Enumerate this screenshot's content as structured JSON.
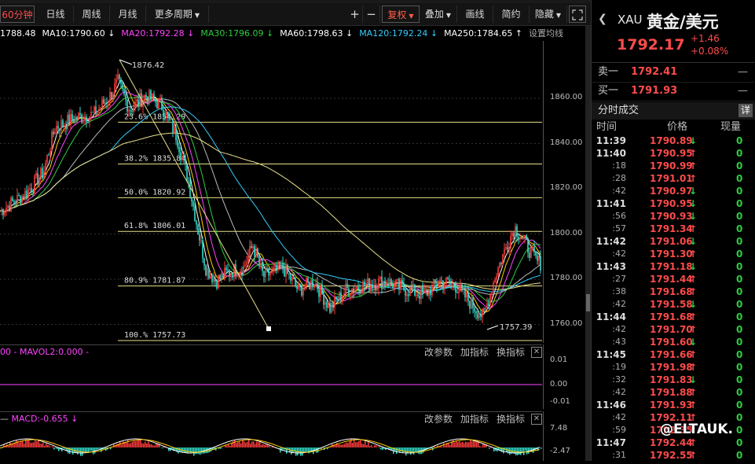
{
  "toolbar": {
    "periods": [
      "60分钟",
      "日线",
      "周线",
      "月线",
      "更多周期"
    ],
    "tools": [
      "+",
      "−",
      "复权",
      "叠加",
      "画线",
      "简约",
      "隐藏"
    ],
    "expand_icon": "expand-icon"
  },
  "ma_line": [
    {
      "text": "1788.48",
      "color": "#ffffff"
    },
    {
      "text": "MA10:1790.60 ↓",
      "color": "#ffffff"
    },
    {
      "text": "MA20:1792.28 ↓",
      "color": "#ff44ff"
    },
    {
      "text": "MA30:1796.09 ↓",
      "color": "#2ecc40"
    },
    {
      "text": "MA60:1798.63 ↓",
      "color": "#ffffff"
    },
    {
      "text": "MA120:1792.24 ↓",
      "color": "#33ccff"
    },
    {
      "text": "MA250:1784.65 ↑",
      "color": "#ffffff"
    },
    {
      "text": "设置均线",
      "color": "#aaaaaa"
    }
  ],
  "main_chart": {
    "y_ticks": [
      "1860.00",
      "1840.00",
      "1820.00",
      "1800.00",
      "1780.00",
      "1760.00"
    ],
    "high_label": "1876.42",
    "low_label": "1757.39",
    "fib_levels": [
      "23.6% 1854.29",
      "38.2% 1835.84",
      "50.0% 1820.92",
      "61.8% 1806.01",
      "80.9% 1781.87",
      "100.% 1757.73"
    ]
  },
  "vol_pane": {
    "header": "00 - MAVOL2:0.000 -",
    "buttons": [
      "改参数",
      "加指标",
      "换指标"
    ],
    "y_ticks": [
      "0.01",
      "0.00",
      "-0.01"
    ]
  },
  "macd_pane": {
    "header": "MACD:-0.655 ↓",
    "buttons": [
      "改参数",
      "加指标",
      "换指标"
    ],
    "y_ticks": [
      "7.48",
      "-2.47"
    ]
  },
  "quote": {
    "code": "XAU",
    "name": "黄金/美元",
    "price": "1792.17",
    "change": "+1.46",
    "change_pct": "+0.08%",
    "sell_label": "卖一",
    "sell_price": "1792.41",
    "buy_label": "买一",
    "buy_price": "1791.93",
    "dash": "—"
  },
  "ticks": {
    "title": "分时成交",
    "detail": "详",
    "headers": [
      "时间",
      "价格",
      "现量"
    ],
    "rows": [
      {
        "time": "11:39",
        "big": true,
        "price": "1790.89",
        "dir": "down",
        "vol": "0"
      },
      {
        "time": "11:40",
        "big": true,
        "price": "1790.95",
        "dir": "up",
        "vol": "0"
      },
      {
        "time": ":18",
        "big": false,
        "price": "1790.99",
        "dir": "up",
        "vol": "0"
      },
      {
        "time": ":28",
        "big": false,
        "price": "1791.01",
        "dir": "up",
        "vol": "0"
      },
      {
        "time": ":42",
        "big": false,
        "price": "1790.97",
        "dir": "down",
        "vol": "0"
      },
      {
        "time": "11:41",
        "big": true,
        "price": "1790.95",
        "dir": "down",
        "vol": "0"
      },
      {
        "time": ":56",
        "big": false,
        "price": "1790.93",
        "dir": "down",
        "vol": "0"
      },
      {
        "time": ":57",
        "big": false,
        "price": "1791.34",
        "dir": "up",
        "vol": "0"
      },
      {
        "time": "11:42",
        "big": true,
        "price": "1791.06",
        "dir": "down",
        "vol": "0"
      },
      {
        "time": ":42",
        "big": false,
        "price": "1791.30",
        "dir": "up",
        "vol": "0"
      },
      {
        "time": "11:43",
        "big": true,
        "price": "1791.18",
        "dir": "down",
        "vol": "0"
      },
      {
        "time": ":27",
        "big": false,
        "price": "1791.44",
        "dir": "up",
        "vol": "0"
      },
      {
        "time": ":38",
        "big": false,
        "price": "1791.68",
        "dir": "up",
        "vol": "0"
      },
      {
        "time": ":42",
        "big": false,
        "price": "1791.58",
        "dir": "down",
        "vol": "0"
      },
      {
        "time": "11:44",
        "big": true,
        "price": "1791.68",
        "dir": "up",
        "vol": "0"
      },
      {
        "time": ":42",
        "big": false,
        "price": "1791.70",
        "dir": "up",
        "vol": "0"
      },
      {
        "time": ":43",
        "big": false,
        "price": "1791.60",
        "dir": "down",
        "vol": "0"
      },
      {
        "time": "11:45",
        "big": true,
        "price": "1791.66",
        "dir": "up",
        "vol": "0"
      },
      {
        "time": ":19",
        "big": false,
        "price": "1791.98",
        "dir": "up",
        "vol": "0"
      },
      {
        "time": ":32",
        "big": false,
        "price": "1791.83",
        "dir": "down",
        "vol": "0"
      },
      {
        "time": ":42",
        "big": false,
        "price": "1791.88",
        "dir": "up",
        "vol": "0"
      },
      {
        "time": "11:46",
        "big": true,
        "price": "1791.93",
        "dir": "up",
        "vol": "0"
      },
      {
        "time": ":42",
        "big": false,
        "price": "1792.11",
        "dir": "up",
        "vol": "0"
      },
      {
        "time": ":59",
        "big": false,
        "price": "1792.35",
        "dir": "up",
        "vol": "0"
      },
      {
        "time": "11:47",
        "big": true,
        "price": "1792.44",
        "dir": "up",
        "vol": "0"
      },
      {
        "time": ":31",
        "big": false,
        "price": "1792.55",
        "dir": "up",
        "vol": "0"
      }
    ]
  },
  "watermark": "@ELTAUK."
}
